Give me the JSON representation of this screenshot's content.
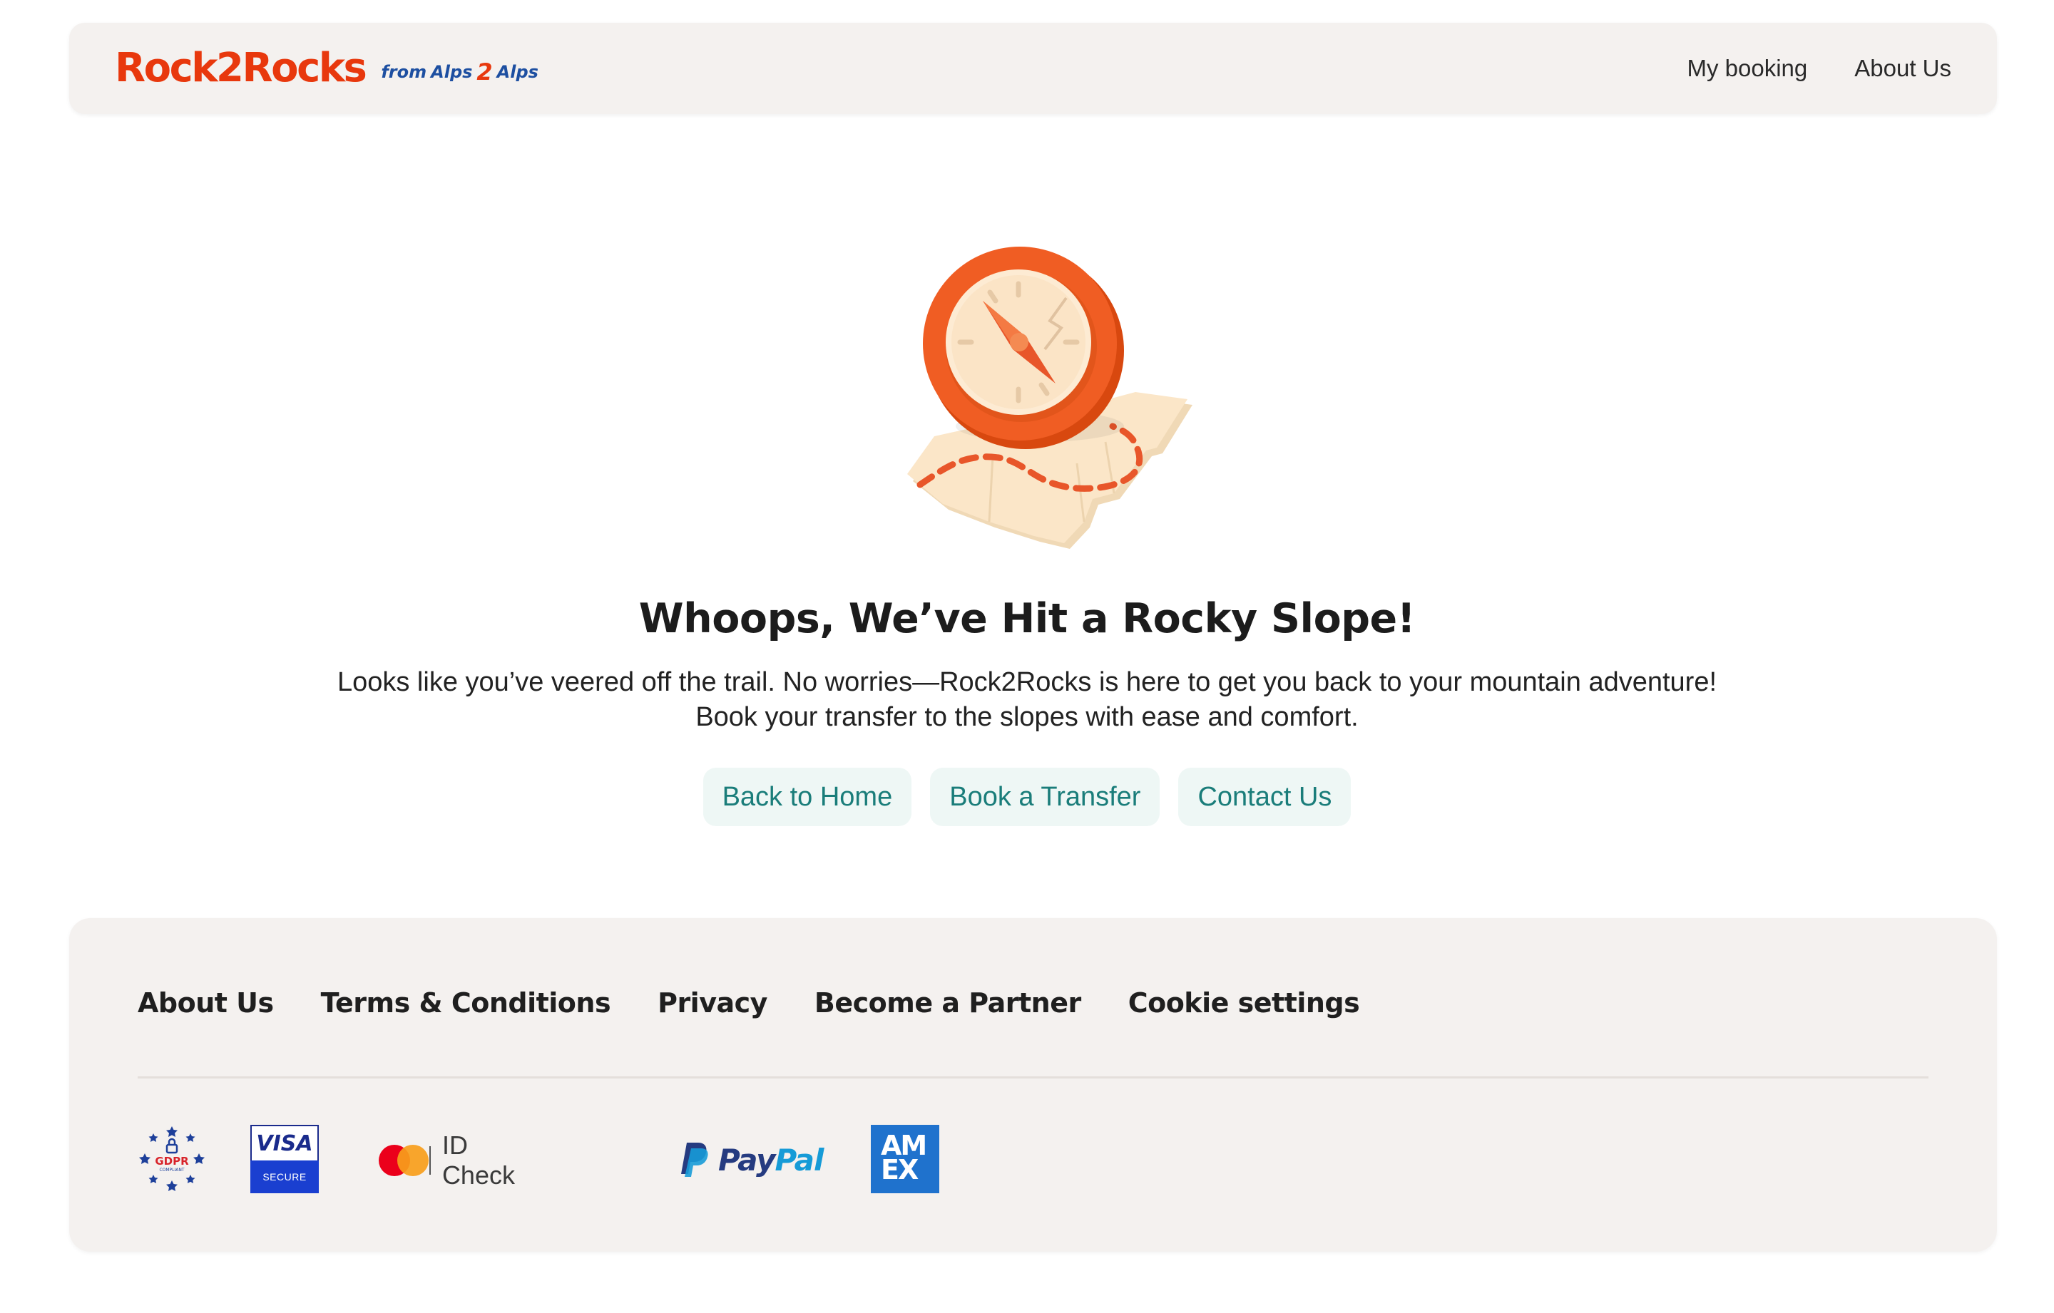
{
  "header": {
    "logo_main": "Rock2Rocks",
    "logo_from": "from",
    "logo_alps1": "Alps",
    "logo_z": "2",
    "logo_alps2": "Alps",
    "nav": {
      "my_booking": "My booking",
      "about_us": "About Us"
    }
  },
  "hero": {
    "illustration_icon": "compass-on-map-icon",
    "title": "Whoops, We’ve Hit a Rocky Slope!",
    "subtitle_line1": "Looks like you’ve veered off the trail. No worries—Rock2Rocks is here to get you back to your mountain adventure!",
    "subtitle_line2": "Book your transfer to the slopes with ease and comfort.",
    "buttons": {
      "back_home": "Back to Home",
      "book_transfer": "Book a Transfer",
      "contact_us": "Contact Us"
    }
  },
  "footer": {
    "links": {
      "about_us": "About Us",
      "terms": "Terms & Conditions",
      "privacy": "Privacy",
      "partner": "Become a Partner",
      "cookies": "Cookie settings"
    },
    "badges": {
      "gdpr": "GDPR",
      "gdpr_sub": "COMPLIANT",
      "visa": "VISA",
      "visa_sub": "SECURE",
      "mastercard_text": "ID Check",
      "paypal_a": "Pay",
      "paypal_b": "Pal",
      "amex_1": "AM",
      "amex_2": "EX"
    }
  },
  "colors": {
    "brand_orange": "#e8380d",
    "brand_blue": "#1d4fa1",
    "cta_text": "#1a7d7a",
    "cta_bg": "#eef7f5",
    "panel_bg": "#f4f1ef"
  }
}
